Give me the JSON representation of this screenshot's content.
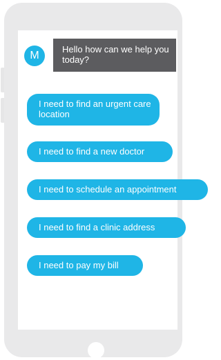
{
  "chat": {
    "avatar_letter": "M",
    "bot_message": "Hello how can we help you today?"
  },
  "options": [
    {
      "label": "I need to find an urgent care location"
    },
    {
      "label": "I need to find a new doctor"
    },
    {
      "label": "I need to schedule an appointment"
    },
    {
      "label": "I need to find a clinic address"
    },
    {
      "label": "I need to pay my bill"
    }
  ],
  "colors": {
    "phone_body": "#e9e9ea",
    "bot_bubble": "#5c5c5f",
    "accent": "#1fb5e6",
    "screen": "#ffffff"
  }
}
